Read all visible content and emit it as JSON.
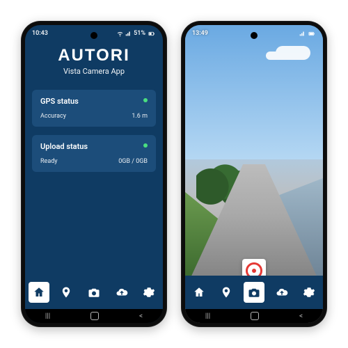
{
  "phone1": {
    "status": {
      "time": "10:43",
      "battery": "51%"
    },
    "brand": "AUTORI",
    "subtitle": "Vista Camera App",
    "gps_card": {
      "title": "GPS status",
      "row_label": "Accuracy",
      "row_value": "1.6 m",
      "indicator": "green"
    },
    "upload_card": {
      "title": "Upload status",
      "row_label": "Ready",
      "row_value": "0GB / 0GB",
      "indicator": "green"
    },
    "nav": {
      "items": [
        "home",
        "location",
        "camera",
        "cloud",
        "settings"
      ],
      "active": "home"
    }
  },
  "phone2": {
    "status": {
      "time": "13:49"
    },
    "nav": {
      "items": [
        "home",
        "location",
        "camera",
        "cloud",
        "settings"
      ],
      "active": "camera"
    },
    "record_button": "record"
  },
  "colors": {
    "app_bg": "#0f3b63",
    "card_bg": "#1c4d7a",
    "accent_green": "#4ade80",
    "record_red": "#e53935"
  }
}
